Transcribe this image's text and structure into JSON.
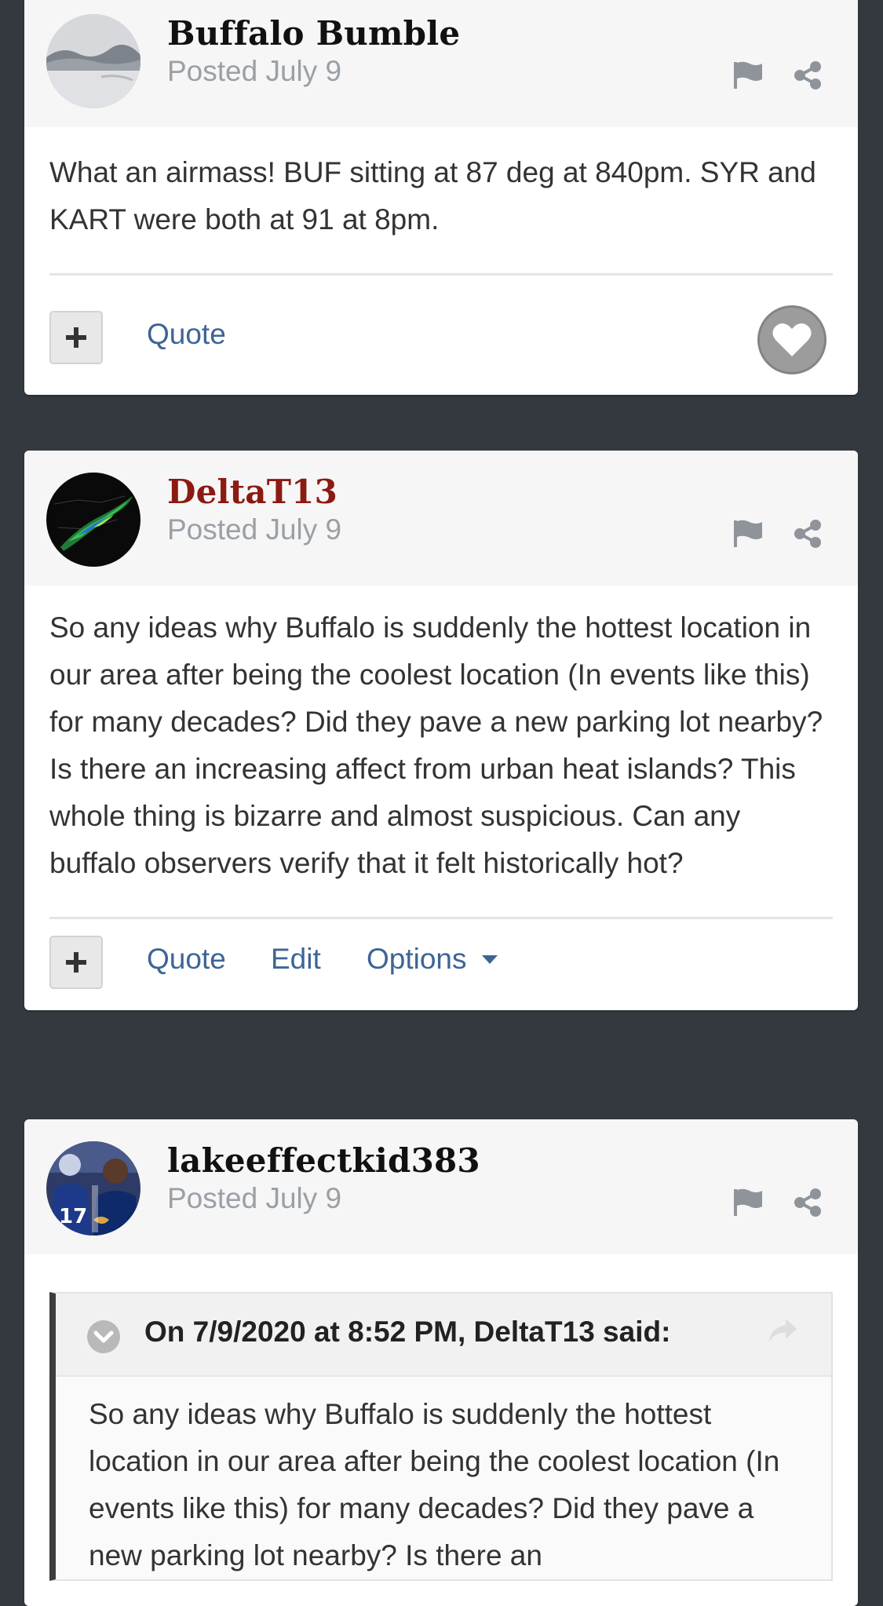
{
  "posts": [
    {
      "author": "Buffalo Bumble",
      "posted": "Posted July 9",
      "avatar_icon": "snowy-landscape-avatar",
      "body": "What an airmass!  BUF sitting at 87 deg at 840pm. SYR and KART were both at 91 at 8pm.",
      "controls": {
        "quote": "Quote"
      }
    },
    {
      "author": "DeltaT13",
      "posted": "Posted July 9",
      "avatar_icon": "radar-map-avatar",
      "body": "So any ideas why Buffalo is suddenly the hottest location in our area after being the coolest location (In events like this) for many decades?  Did they pave a new parking lot nearby?  Is there an increasing affect from urban heat islands?  This whole thing is bizarre and almost suspicious. Can any buffalo observers verify that it felt historically hot?",
      "controls": {
        "quote": "Quote",
        "edit": "Edit",
        "options": "Options"
      }
    },
    {
      "author": "lakeeffectkid383",
      "posted": "Posted July 9",
      "avatar_icon": "football-players-avatar",
      "quote": {
        "citation": "On 7/9/2020 at 8:52 PM, DeltaT13 said:",
        "text": "So any ideas why Buffalo is suddenly the hottest location in our area after being the coolest location (In events like this) for many decades?  Did they pave a new parking lot nearby?  Is there an"
      }
    }
  ],
  "colors": {
    "page_background": "#33393f",
    "card_background": "#ffffff",
    "header_background": "#f6f6f6",
    "link": "#3d6594",
    "highlight_author": "#8b1a12",
    "muted": "#9aa0a6"
  },
  "icons": {
    "report": "flag-icon",
    "share": "share-icon",
    "add": "plus-icon",
    "like": "heart-icon",
    "options": "caret-down-icon",
    "quote_toggle": "chevron-down-icon",
    "quote_jump": "forward-arrow-icon"
  }
}
